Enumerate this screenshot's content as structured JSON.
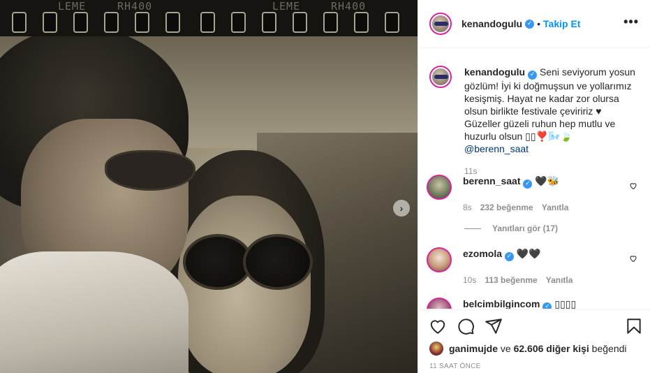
{
  "photo": {
    "film_labels": [
      "LEME",
      "RH400",
      "LEME",
      "RH400"
    ],
    "next_icon": "chevron-right-icon"
  },
  "header": {
    "username": "kenandogulu",
    "separator": "•",
    "follow_label": "Takip Et",
    "more_label": "•••"
  },
  "caption": {
    "username": "kenandogulu",
    "text": "Seni seviyorum yosun gözlüm! İyi ki doğmuşsun ve yollarımız kesişmiş. Hayat ne kadar zor olursa olsun birlikte festivale çeviririz ♥ Güzeller güzeli ruhun hep mutlu ve huzurlu olsun ▯▯❣️🌬️🍃 ",
    "mention": "@berenn_saat",
    "time": "11s"
  },
  "comments": [
    {
      "username": "berenn_saat",
      "text": "🖤🐝",
      "time": "8s",
      "likes": "232 beğenme",
      "reply": "Yanıtla"
    },
    {
      "username": "ezomola",
      "text": "🖤🖤",
      "time": "10s",
      "likes": "113 beğenme",
      "reply": "Yanıtla"
    },
    {
      "username": "belcimbilgincom",
      "text": "▯▯▯▯"
    }
  ],
  "view_replies": "Yanıtları gör (17)",
  "footer": {
    "liked_by_user": "ganimujde",
    "liked_by_conj": "ve",
    "liked_by_count": "62.606 diğer kişi",
    "liked_by_suffix": "beğendi",
    "timestamp": "11 SAAT ÖNCE"
  },
  "colors": {
    "accent": "#0095f6",
    "verified": "#3897f0",
    "muted": "#8e8e8e",
    "text": "#262626"
  }
}
